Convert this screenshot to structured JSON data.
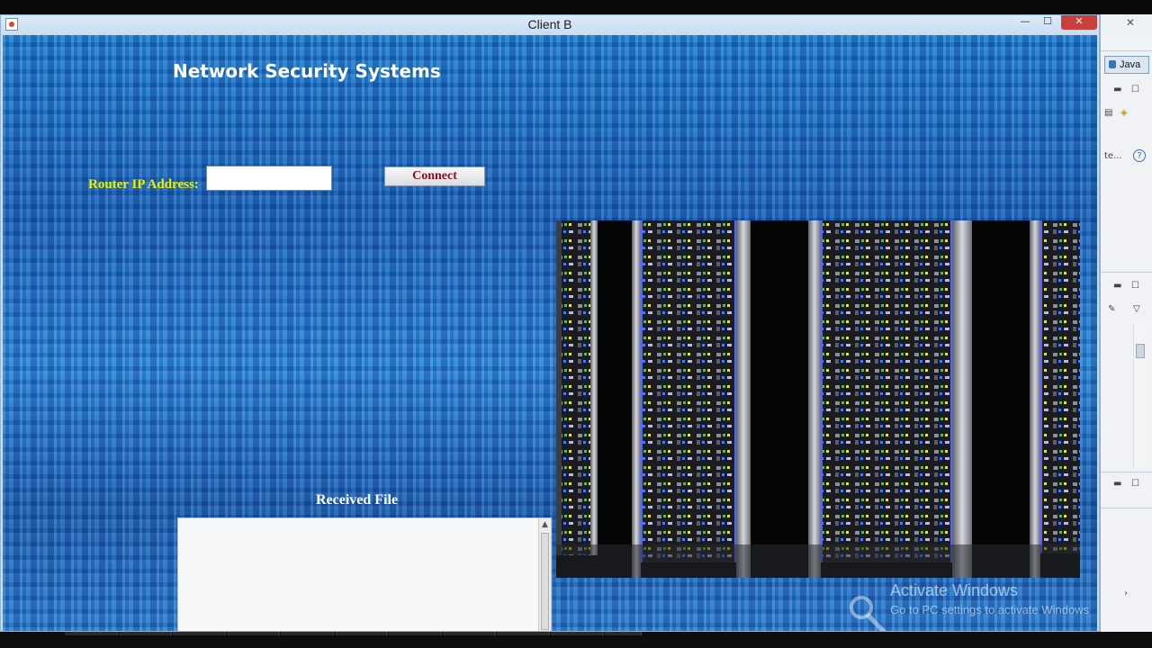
{
  "window": {
    "title": "Client B",
    "controls": {
      "minimize": "—",
      "maximize": "☐",
      "close": "✕"
    }
  },
  "app": {
    "heading": "Network Security Systems",
    "router_ip_label": "Router IP Address:",
    "router_ip_value": "",
    "connect_label": "Connect",
    "received_file_label": "Received File",
    "received_file_content": ""
  },
  "watermark": {
    "line1": "Activate Windows",
    "line2": "Go to PC settings to activate Windows"
  },
  "ide_panel": {
    "perspective_tab": "Java",
    "truncated_label": "te...",
    "help_glyph": "?"
  },
  "colors": {
    "label_yellow": "#e8f000",
    "connect_text": "#8b0f1a",
    "close_red": "#c9403a"
  }
}
